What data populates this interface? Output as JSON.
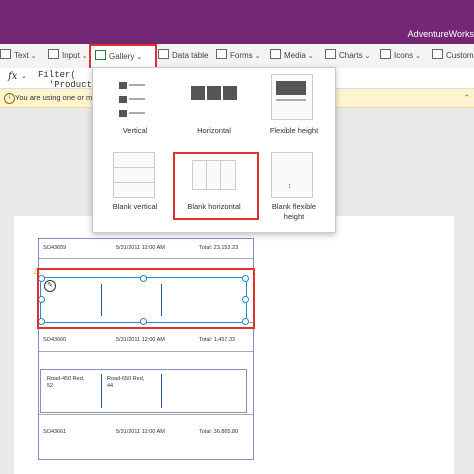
{
  "app": {
    "title": "AdventureWorks"
  },
  "ribbon": {
    "text_label": "Text",
    "input_label": "Input",
    "gallery_label": "Gallery",
    "datatable_label": "Data table",
    "forms_label": "Forms",
    "media_label": "Media",
    "charts_label": "Charts",
    "icons_label": "Icons",
    "custom_label": "Custom"
  },
  "formula": {
    "fx": "fx",
    "line1": "Filter(",
    "line2": "  'Product"
  },
  "warning": {
    "text": "You are using one or more i"
  },
  "gallery_menu": {
    "vertical": "Vertical",
    "horizontal": "Horizontal",
    "flexible_height": "Flexible height",
    "blank_vertical": "Blank vertical",
    "blank_horizontal": "Blank horizontal",
    "blank_flexible_height_1": "Blank flexible",
    "blank_flexible_height_2": "height"
  },
  "orders": [
    {
      "id": "SO43659",
      "date": "5/31/2011 12:00 AM",
      "total": "Total: 23,153.23"
    },
    {
      "id": "SO43660",
      "date": "5/31/2011 12:00 AM",
      "total": "Total: 1,457.33"
    },
    {
      "id": "SO43661",
      "date": "5/31/2011 12:00 AM",
      "total": "Total: 36,865.80"
    }
  ],
  "products": [
    {
      "name_1": "Road-450 Red,",
      "name_2": "52"
    },
    {
      "name_1": "Road-650 Red,",
      "name_2": "44"
    }
  ]
}
